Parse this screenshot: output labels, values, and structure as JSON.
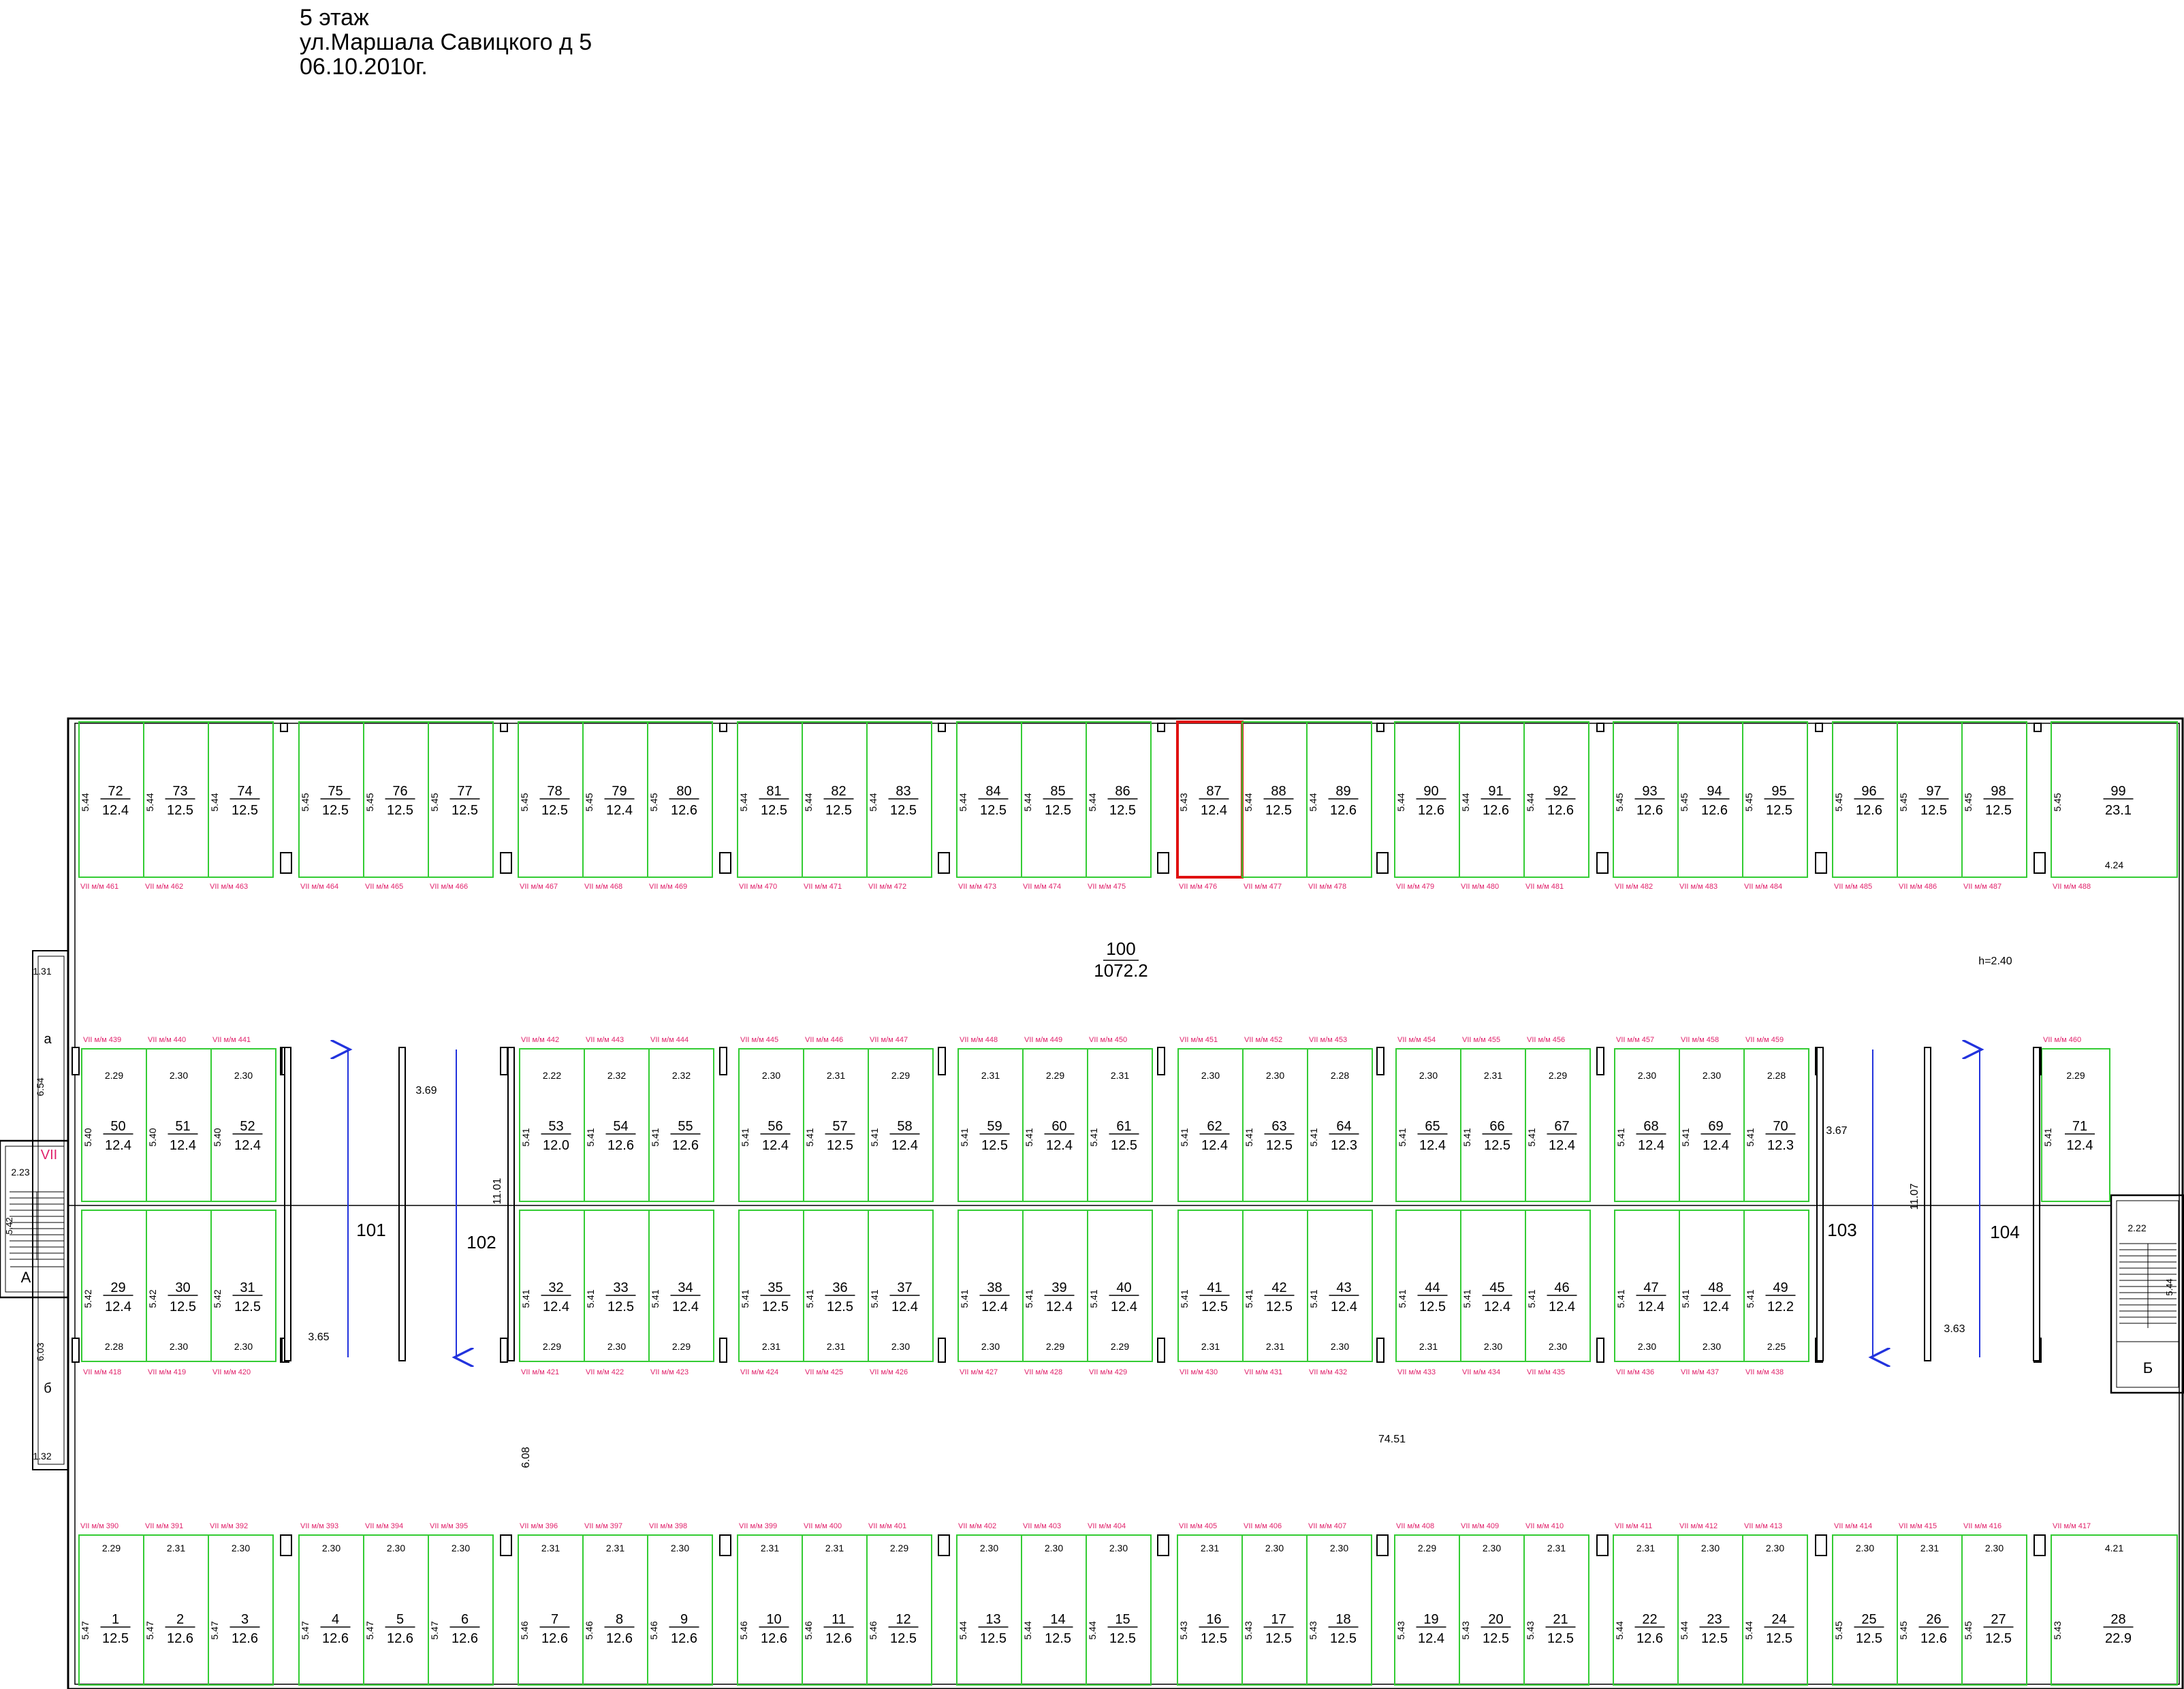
{
  "header": {
    "line1": "5 этаж",
    "line2": "ул.Маршала Савицкого д 5",
    "line3": "06.10.2010г."
  },
  "colors": {
    "cell": "#33cc33",
    "wall": "#000000",
    "highlight": "#e01010",
    "tag": "#e0206a",
    "arrow": "#2233dd"
  },
  "rows": {
    "top": [
      [
        "72",
        "12.4",
        "5.44",
        "",
        "VII м/м 461"
      ],
      [
        "73",
        "12.5",
        "5.44",
        "",
        "VII м/м 462"
      ],
      [
        "74",
        "12.5",
        "5.44",
        "",
        "VII м/м 463"
      ],
      [
        "75",
        "12.5",
        "5.45",
        "",
        "VII м/м 464"
      ],
      [
        "76",
        "12.5",
        "5.45",
        "",
        "VII м/м 465"
      ],
      [
        "77",
        "12.5",
        "5.45",
        "",
        "VII м/м 466"
      ],
      [
        "78",
        "12.5",
        "5.45",
        "",
        "VII м/м 467"
      ],
      [
        "79",
        "12.4",
        "5.45",
        "",
        "VII м/м 468"
      ],
      [
        "80",
        "12.6",
        "5.45",
        "",
        "VII м/м 469"
      ],
      [
        "81",
        "12.5",
        "5.44",
        "",
        "VII м/м 470"
      ],
      [
        "82",
        "12.5",
        "5.44",
        "",
        "VII м/м 471"
      ],
      [
        "83",
        "12.5",
        "5.44",
        "",
        "VII м/м 472"
      ],
      [
        "84",
        "12.5",
        "5.44",
        "",
        "VII м/м 473"
      ],
      [
        "85",
        "12.5",
        "5.44",
        "",
        "VII м/м 474"
      ],
      [
        "86",
        "12.5",
        "5.44",
        "",
        "VII м/м 475"
      ],
      [
        "87",
        "12.4",
        "5.43",
        "",
        "VII м/м 476"
      ],
      [
        "88",
        "12.5",
        "5.44",
        "",
        "VII м/м 477"
      ],
      [
        "89",
        "12.6",
        "5.44",
        "",
        "VII м/м 478"
      ],
      [
        "90",
        "12.6",
        "5.44",
        "",
        "VII м/м 479"
      ],
      [
        "91",
        "12.6",
        "5.44",
        "",
        "VII м/м 480"
      ],
      [
        "92",
        "12.6",
        "5.44",
        "",
        "VII м/м 481"
      ],
      [
        "93",
        "12.6",
        "5.45",
        "",
        "VII м/м 482"
      ],
      [
        "94",
        "12.6",
        "5.45",
        "",
        "VII м/м 483"
      ],
      [
        "95",
        "12.5",
        "5.45",
        "",
        "VII м/м 484"
      ],
      [
        "96",
        "12.6",
        "5.45",
        "",
        "VII м/м 485"
      ],
      [
        "97",
        "12.5",
        "5.45",
        "",
        "VII м/м 486"
      ],
      [
        "98",
        "12.5",
        "5.45",
        "",
        "VII м/м 487"
      ],
      [
        "99",
        "23.1",
        "5.45",
        "4.24",
        "VII м/м 488"
      ]
    ],
    "mid1": [
      [
        "50",
        "12.4",
        "5.40",
        "2.29",
        "VII м/м 439"
      ],
      [
        "51",
        "12.4",
        "5.40",
        "2.30",
        "VII м/м 440"
      ],
      [
        "52",
        "12.4",
        "5.40",
        "2.30",
        "VII м/м 441"
      ],
      [
        "53",
        "12.0",
        "5.41",
        "2.22",
        "VII м/м 442"
      ],
      [
        "54",
        "12.6",
        "5.41",
        "2.32",
        "VII м/м 443"
      ],
      [
        "55",
        "12.6",
        "5.41",
        "2.32",
        "VII м/м 444"
      ],
      [
        "56",
        "12.4",
        "5.41",
        "2.30",
        "VII м/м 445"
      ],
      [
        "57",
        "12.5",
        "5.41",
        "2.31",
        "VII м/м 446"
      ],
      [
        "58",
        "12.4",
        "5.41",
        "2.29",
        "VII м/м 447"
      ],
      [
        "59",
        "12.5",
        "5.41",
        "2.31",
        "VII м/м 448"
      ],
      [
        "60",
        "12.4",
        "5.41",
        "2.29",
        "VII м/м 449"
      ],
      [
        "61",
        "12.5",
        "5.41",
        "2.31",
        "VII м/м 450"
      ],
      [
        "62",
        "12.4",
        "5.41",
        "2.30",
        "VII м/м 451"
      ],
      [
        "63",
        "12.5",
        "5.41",
        "2.30",
        "VII м/м 452"
      ],
      [
        "64",
        "12.3",
        "5.41",
        "2.28",
        "VII м/м 453"
      ],
      [
        "65",
        "12.4",
        "5.41",
        "2.30",
        "VII м/м 454"
      ],
      [
        "66",
        "12.5",
        "5.41",
        "2.31",
        "VII м/м 455"
      ],
      [
        "67",
        "12.4",
        "5.41",
        "2.29",
        "VII м/м 456"
      ],
      [
        "68",
        "12.4",
        "5.41",
        "2.30",
        "VII м/м 457"
      ],
      [
        "69",
        "12.4",
        "5.41",
        "2.30",
        "VII м/м 458"
      ],
      [
        "70",
        "12.3",
        "5.41",
        "2.28",
        "VII м/м 459"
      ],
      [
        "71",
        "12.4",
        "5.41",
        "2.29",
        "VII м/м 460"
      ]
    ],
    "mid2": [
      [
        "29",
        "12.4",
        "5.42",
        "2.28",
        "VII м/м 418"
      ],
      [
        "30",
        "12.5",
        "5.42",
        "2.30",
        "VII м/м 419"
      ],
      [
        "31",
        "12.5",
        "5.42",
        "2.30",
        "VII м/м 420"
      ],
      [
        "32",
        "12.4",
        "5.41",
        "2.29",
        "VII м/м 421"
      ],
      [
        "33",
        "12.5",
        "5.41",
        "2.30",
        "VII м/м 422"
      ],
      [
        "34",
        "12.4",
        "5.41",
        "2.29",
        "VII м/м 423"
      ],
      [
        "35",
        "12.5",
        "5.41",
        "2.31",
        "VII м/м 424"
      ],
      [
        "36",
        "12.5",
        "5.41",
        "2.31",
        "VII м/м 425"
      ],
      [
        "37",
        "12.4",
        "5.41",
        "2.30",
        "VII м/м 426"
      ],
      [
        "38",
        "12.4",
        "5.41",
        "2.30",
        "VII м/м 427"
      ],
      [
        "39",
        "12.4",
        "5.41",
        "2.29",
        "VII м/м 428"
      ],
      [
        "40",
        "12.4",
        "5.41",
        "2.29",
        "VII м/м 429"
      ],
      [
        "41",
        "12.5",
        "5.41",
        "2.31",
        "VII м/м 430"
      ],
      [
        "42",
        "12.5",
        "5.41",
        "2.31",
        "VII м/м 431"
      ],
      [
        "43",
        "12.4",
        "5.41",
        "2.30",
        "VII м/м 432"
      ],
      [
        "44",
        "12.5",
        "5.41",
        "2.31",
        "VII м/м 433"
      ],
      [
        "45",
        "12.4",
        "5.41",
        "2.30",
        "VII м/м 434"
      ],
      [
        "46",
        "12.4",
        "5.41",
        "2.30",
        "VII м/м 435"
      ],
      [
        "47",
        "12.4",
        "5.41",
        "2.30",
        "VII м/м 436"
      ],
      [
        "48",
        "12.4",
        "5.41",
        "2.30",
        "VII м/м 437"
      ],
      [
        "49",
        "12.2",
        "5.41",
        "2.25",
        "VII м/м 438"
      ]
    ],
    "bottom": [
      [
        "1",
        "12.5",
        "5.47",
        "2.29",
        "VII м/м 390"
      ],
      [
        "2",
        "12.6",
        "5.47",
        "2.31",
        "VII м/м 391"
      ],
      [
        "3",
        "12.6",
        "5.47",
        "2.30",
        "VII м/м 392"
      ],
      [
        "4",
        "12.6",
        "5.47",
        "2.30",
        "VII м/м 393"
      ],
      [
        "5",
        "12.6",
        "5.47",
        "2.30",
        "VII м/м 394"
      ],
      [
        "6",
        "12.6",
        "5.47",
        "2.30",
        "VII м/м 395"
      ],
      [
        "7",
        "12.6",
        "5.46",
        "2.31",
        "VII м/м 396"
      ],
      [
        "8",
        "12.6",
        "5.46",
        "2.31",
        "VII м/м 397"
      ],
      [
        "9",
        "12.6",
        "5.46",
        "2.30",
        "VII м/м 398"
      ],
      [
        "10",
        "12.6",
        "5.46",
        "2.31",
        "VII м/м 399"
      ],
      [
        "11",
        "12.6",
        "5.46",
        "2.31",
        "VII м/м 400"
      ],
      [
        "12",
        "12.5",
        "5.46",
        "2.29",
        "VII м/м 401"
      ],
      [
        "13",
        "12.5",
        "5.44",
        "2.30",
        "VII м/м 402"
      ],
      [
        "14",
        "12.5",
        "5.44",
        "2.30",
        "VII м/м 403"
      ],
      [
        "15",
        "12.5",
        "5.44",
        "2.30",
        "VII м/м 404"
      ],
      [
        "16",
        "12.5",
        "5.43",
        "2.31",
        "VII м/м 405"
      ],
      [
        "17",
        "12.5",
        "5.43",
        "2.30",
        "VII м/м 406"
      ],
      [
        "18",
        "12.5",
        "5.43",
        "2.30",
        "VII м/м 407"
      ],
      [
        "19",
        "12.4",
        "5.43",
        "2.29",
        "VII м/м 408"
      ],
      [
        "20",
        "12.5",
        "5.43",
        "2.30",
        "VII м/м 409"
      ],
      [
        "21",
        "12.5",
        "5.43",
        "2.31",
        "VII м/м 410"
      ],
      [
        "22",
        "12.6",
        "5.44",
        "2.31",
        "VII м/м 411"
      ],
      [
        "23",
        "12.5",
        "5.44",
        "2.30",
        "VII м/м 412"
      ],
      [
        "24",
        "12.5",
        "5.44",
        "2.30",
        "VII м/м 413"
      ],
      [
        "25",
        "12.5",
        "5.45",
        "2.30",
        "VII м/м 414"
      ],
      [
        "26",
        "12.6",
        "5.45",
        "2.31",
        "VII м/м 415"
      ],
      [
        "27",
        "12.5",
        "5.45",
        "2.30",
        "VII м/м 416"
      ],
      [
        "28",
        "22.9",
        "5.43",
        "4.21",
        "VII м/м 417"
      ]
    ]
  },
  "labels": {
    "hall_num": "100",
    "hall_area": "1072.2",
    "height": "h=2.40",
    "r101": "101",
    "r102": "102",
    "r103": "103",
    "r104": "104",
    "d369": "3.69",
    "d365": "3.65",
    "d1101": "11.01",
    "d367": "3.67",
    "d363": "3.63",
    "d1107": "11.07",
    "d7451": "74.51",
    "d608": "6.08",
    "stairL": "VII",
    "stairL_dim": "2.23",
    "stairL_dim2": "5.42",
    "stairL_letter": "А",
    "stairR_dim": "2.22",
    "stairR_dim2": "5.44",
    "stairR_letter": "Б",
    "vest_a": "а",
    "vest_b": "б",
    "d131": "1.31",
    "d654": "6.54",
    "d603": "6.03",
    "d132": "1.32"
  }
}
